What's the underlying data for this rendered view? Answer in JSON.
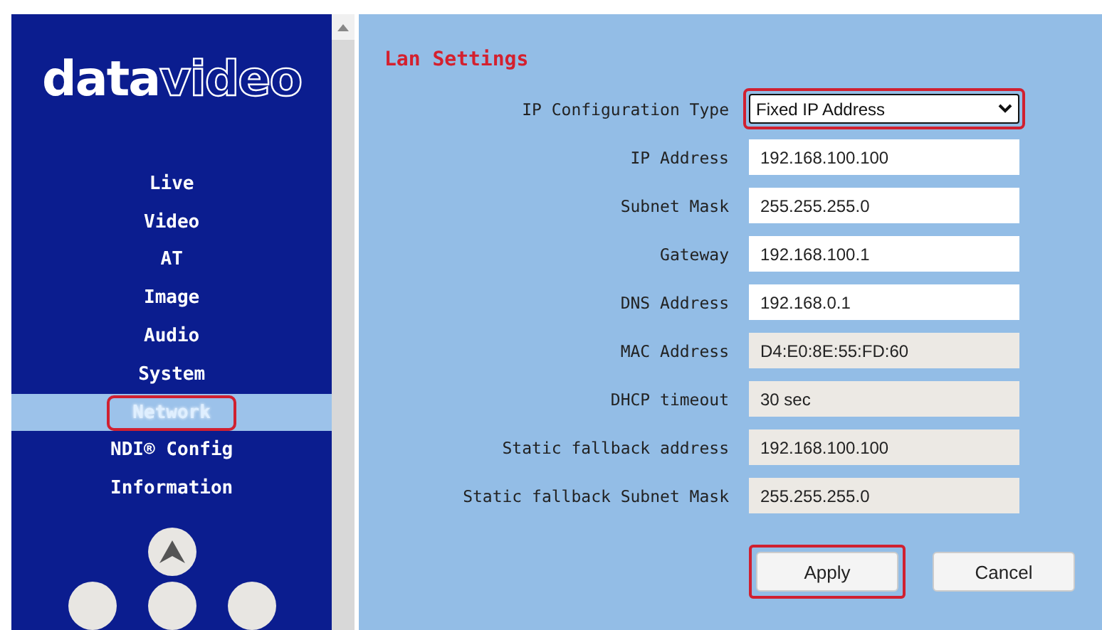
{
  "logo": {
    "bold": "data",
    "light": "video"
  },
  "nav": [
    {
      "label": "Live",
      "selected": false,
      "highlighted": false
    },
    {
      "label": "Video",
      "selected": false,
      "highlighted": false
    },
    {
      "label": "AT",
      "selected": false,
      "highlighted": false
    },
    {
      "label": "Image",
      "selected": false,
      "highlighted": false
    },
    {
      "label": "Audio",
      "selected": false,
      "highlighted": false
    },
    {
      "label": "System",
      "selected": false,
      "highlighted": false
    },
    {
      "label": "Network",
      "selected": true,
      "highlighted": true
    },
    {
      "label": "NDI® Config",
      "selected": false,
      "highlighted": false
    },
    {
      "label": "Information",
      "selected": false,
      "highlighted": false
    }
  ],
  "title": "Lan Settings",
  "fields": [
    {
      "label": "IP Configuration Type",
      "kind": "select",
      "value": "Fixed IP Address",
      "highlighted": true
    },
    {
      "label": "IP Address",
      "kind": "input",
      "value": "192.168.100.100",
      "readonly": false
    },
    {
      "label": "Subnet Mask",
      "kind": "input",
      "value": "255.255.255.0",
      "readonly": false
    },
    {
      "label": "Gateway",
      "kind": "input",
      "value": "192.168.100.1",
      "readonly": false
    },
    {
      "label": "DNS Address",
      "kind": "input",
      "value": "192.168.0.1",
      "readonly": false
    },
    {
      "label": "MAC Address",
      "kind": "input",
      "value": "D4:E0:8E:55:FD:60",
      "readonly": true
    },
    {
      "label": "DHCP timeout",
      "kind": "input",
      "value": "30 sec",
      "readonly": true
    },
    {
      "label": "Static fallback address",
      "kind": "input",
      "value": "192.168.100.100",
      "readonly": true
    },
    {
      "label": "Static fallback Subnet Mask",
      "kind": "input",
      "value": "255.255.255.0",
      "readonly": true
    }
  ],
  "buttons": [
    {
      "label": "Apply",
      "highlighted": true
    },
    {
      "label": "Cancel",
      "highlighted": false
    }
  ]
}
